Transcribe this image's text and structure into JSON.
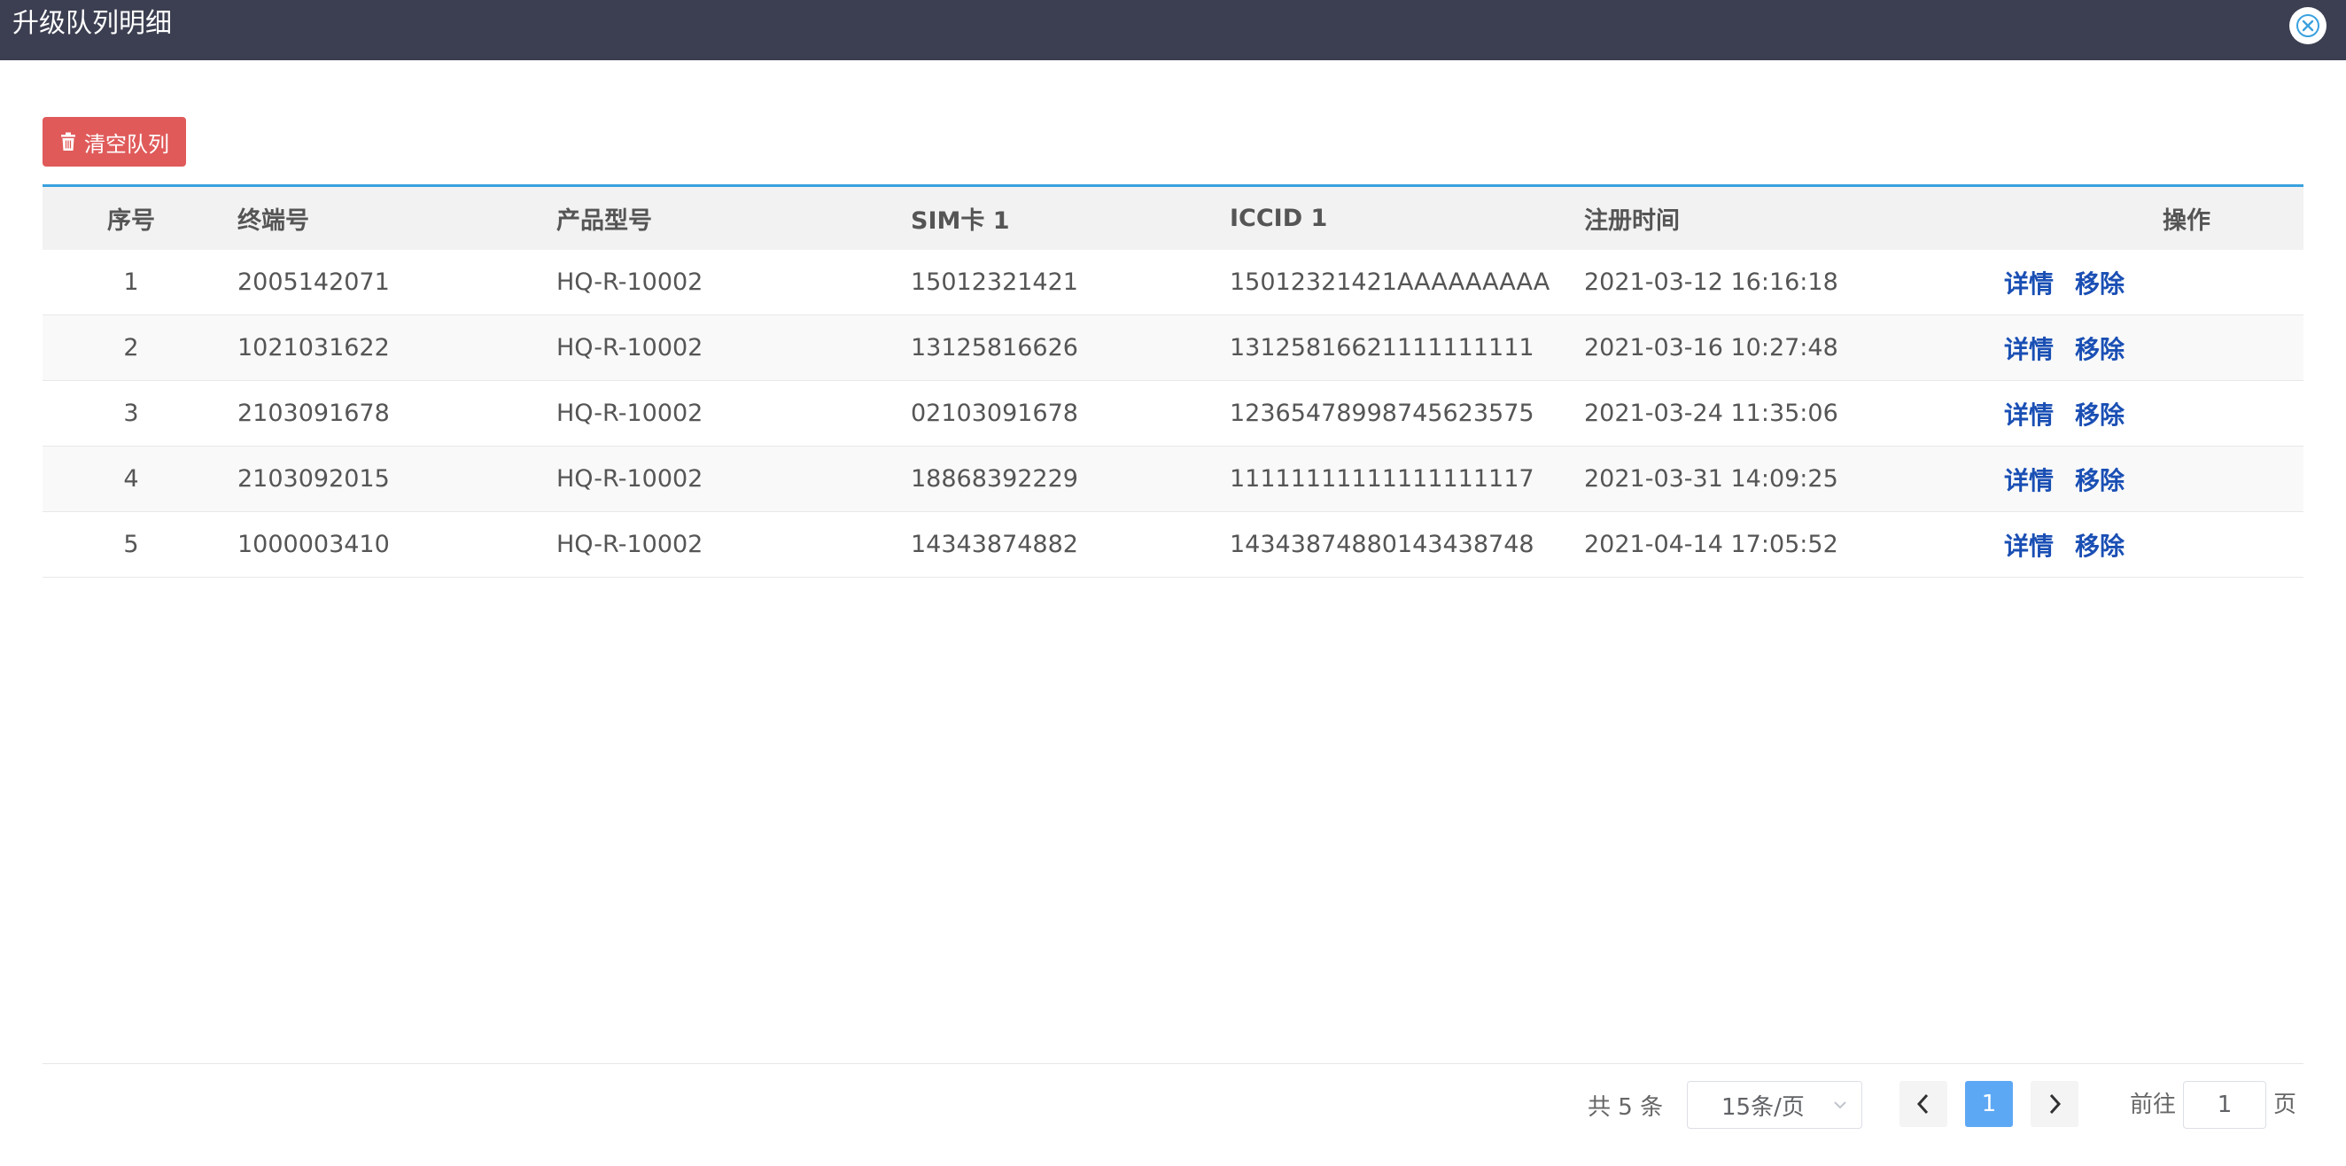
{
  "dialog": {
    "title": "升级队列明细"
  },
  "toolbar": {
    "clear_label": "清空队列"
  },
  "table": {
    "columns": [
      "序号",
      "终端号",
      "产品型号",
      "SIM卡 1",
      "ICCID 1",
      "注册时间",
      "操作"
    ],
    "rows": [
      {
        "index": "1",
        "terminal": "2005142071",
        "model": "HQ-R-10002",
        "sim": "15012321421",
        "iccid": "15012321421AAAAAAAAA",
        "time": "2021-03-12 16:16:18",
        "detail": "详情",
        "remove": "移除"
      },
      {
        "index": "2",
        "terminal": "1021031622",
        "model": "HQ-R-10002",
        "sim": "13125816626",
        "iccid": "13125816621111111111",
        "time": "2021-03-16 10:27:48",
        "detail": "详情",
        "remove": "移除"
      },
      {
        "index": "3",
        "terminal": "2103091678",
        "model": "HQ-R-10002",
        "sim": "02103091678",
        "iccid": "12365478998745623575",
        "time": "2021-03-24 11:35:06",
        "detail": "详情",
        "remove": "移除"
      },
      {
        "index": "4",
        "terminal": "2103092015",
        "model": "HQ-R-10002",
        "sim": "18868392229",
        "iccid": "11111111111111111117",
        "time": "2021-03-31 14:09:25",
        "detail": "详情",
        "remove": "移除"
      },
      {
        "index": "5",
        "terminal": "1000003410",
        "model": "HQ-R-10002",
        "sim": "14343874882",
        "iccid": "14343874880143438748",
        "time": "2021-04-14 17:05:52",
        "detail": "详情",
        "remove": "移除"
      }
    ]
  },
  "pagination": {
    "total_text": "共 5 条",
    "page_size": "15条/页",
    "current_page": "1",
    "goto_label": "前往",
    "goto_value": "1",
    "page_unit": "页"
  },
  "colors": {
    "header_bg": "#3c3f51",
    "danger": "#e05a5a",
    "accent": "#3aa1df",
    "link": "#1a4fb4",
    "active_page": "#5da8f5"
  }
}
